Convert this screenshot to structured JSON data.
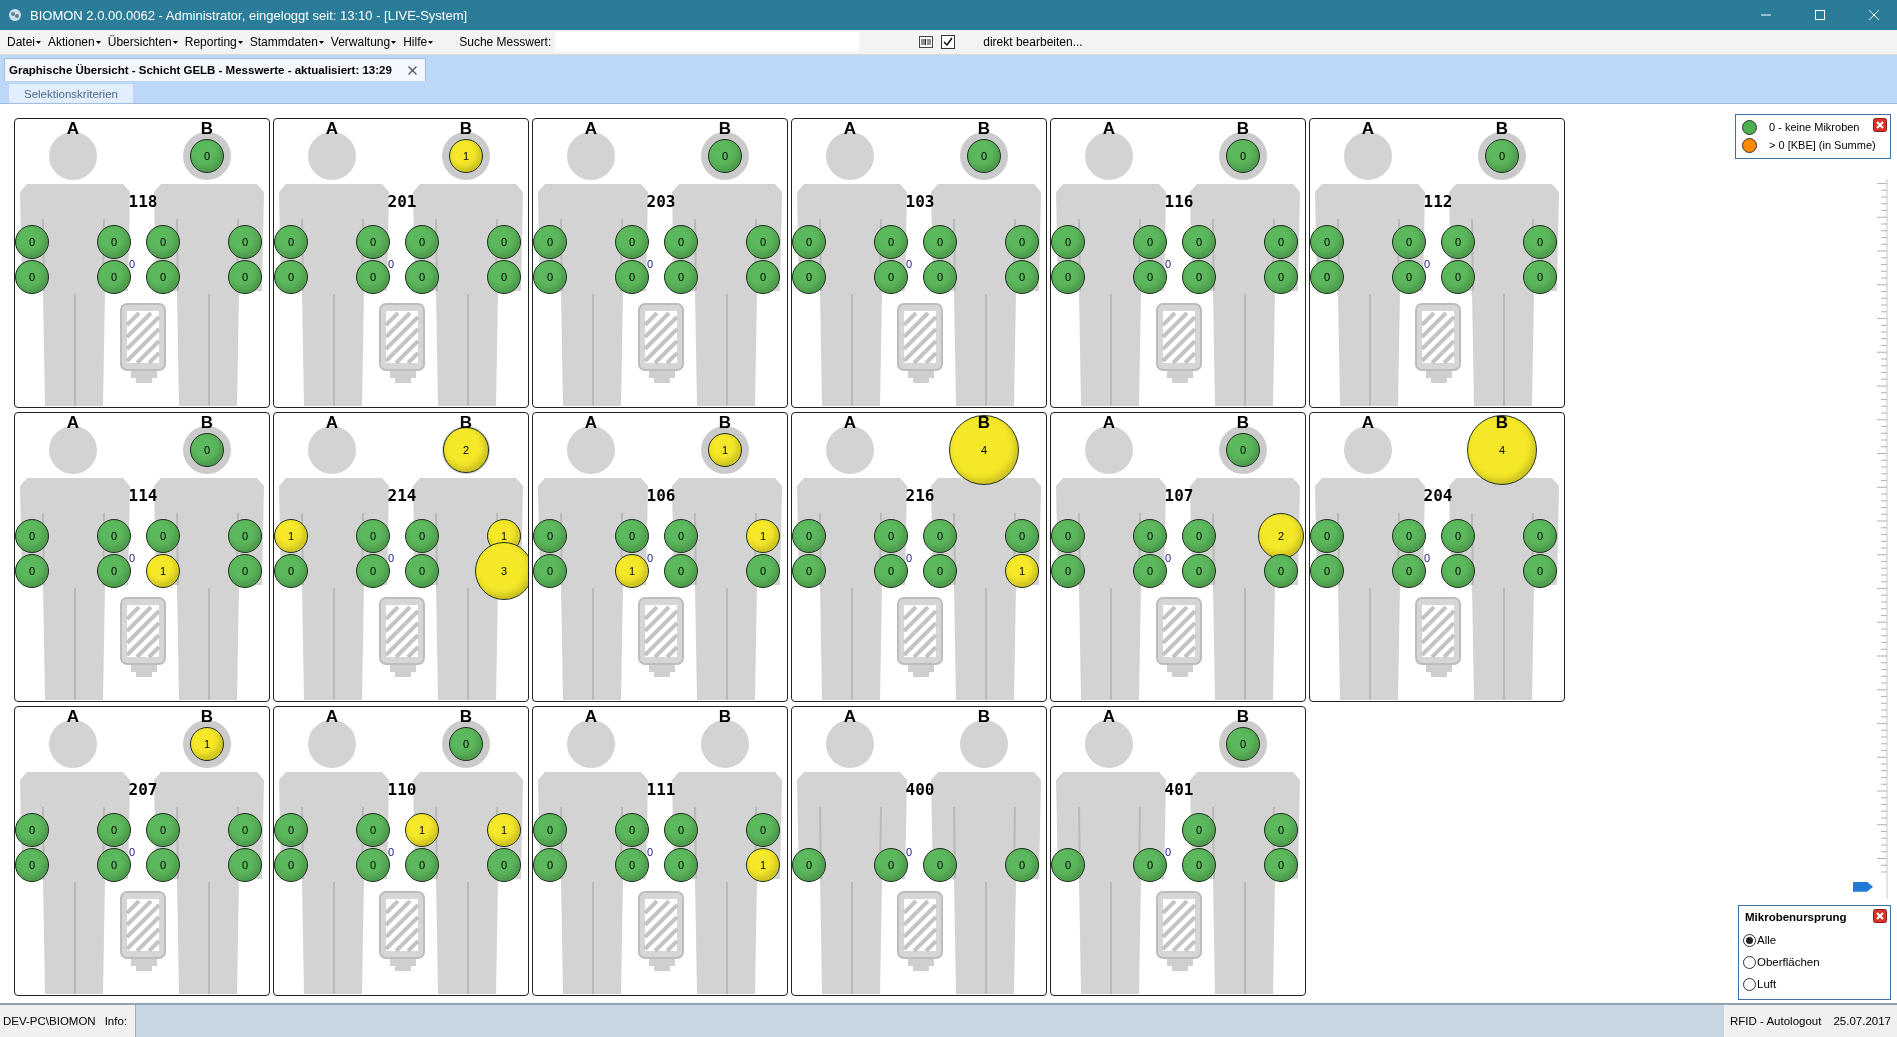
{
  "window": {
    "title": "BIOMON 2.0.00.0062 - Administrator, eingeloggt seit: 13:10 - [LIVE-System]"
  },
  "menu": [
    {
      "label": "Datei"
    },
    {
      "label": "Aktionen"
    },
    {
      "label": "Übersichten"
    },
    {
      "label": "Reporting"
    },
    {
      "label": "Stammdaten"
    },
    {
      "label": "Verwaltung"
    },
    {
      "label": "Hilfe"
    }
  ],
  "search": {
    "label": "Suche Messwert:"
  },
  "edit_toggle": {
    "checked": true,
    "label": "direkt bearbeiten..."
  },
  "tabs": [
    {
      "label": "Graphische Übersicht - Schicht GELB - Messwerte - aktualisiert: 13:29",
      "selected": true
    }
  ],
  "subtabs": [
    {
      "label": "Selektionskriterien",
      "selected": true
    }
  ],
  "rooms": [
    {
      "number": "118",
      "labels": [
        "A",
        "B"
      ],
      "head": {
        "value": "0",
        "color": "#5cb85c"
      },
      "hands": [
        {
          "upper": {
            "value": "0",
            "color": "#5cb85c"
          },
          "lower": {
            "value": "0",
            "color": "#5cb85c"
          }
        },
        {
          "upper": {
            "value": "0",
            "color": "#5cb85c"
          },
          "lower": {
            "value": "0",
            "color": "#5cb85c"
          }
        },
        {
          "upper": {
            "value": "0",
            "color": "#5cb85c"
          },
          "lower": {
            "value": "0",
            "color": "#5cb85c"
          }
        },
        {
          "upper": {
            "value": "0",
            "color": "#5cb85c"
          },
          "lower": {
            "value": "0",
            "color": "#5cb85c"
          }
        }
      ],
      "center": "0"
    },
    {
      "number": "201",
      "labels": [
        "A",
        "B"
      ],
      "head": {
        "value": "1",
        "color": "#f5e829"
      },
      "hands": [
        {
          "upper": {
            "value": "0",
            "color": "#5cb85c"
          },
          "lower": {
            "value": "0",
            "color": "#5cb85c"
          }
        },
        {
          "upper": {
            "value": "0",
            "color": "#5cb85c"
          },
          "lower": {
            "value": "0",
            "color": "#5cb85c"
          }
        },
        {
          "upper": {
            "value": "0",
            "color": "#5cb85c"
          },
          "lower": {
            "value": "0",
            "color": "#5cb85c"
          }
        },
        {
          "upper": {
            "value": "0",
            "color": "#5cb85c"
          },
          "lower": {
            "value": "0",
            "color": "#5cb85c"
          }
        }
      ],
      "center": "0"
    },
    {
      "number": "203",
      "labels": [
        "A",
        "B"
      ],
      "head": {
        "value": "0",
        "color": "#5cb85c"
      },
      "hands": [
        {
          "upper": {
            "value": "0",
            "color": "#5cb85c"
          },
          "lower": {
            "value": "0",
            "color": "#5cb85c"
          }
        },
        {
          "upper": {
            "value": "0",
            "color": "#5cb85c"
          },
          "lower": {
            "value": "0",
            "color": "#5cb85c"
          }
        },
        {
          "upper": {
            "value": "0",
            "color": "#5cb85c"
          },
          "lower": {
            "value": "0",
            "color": "#5cb85c"
          }
        },
        {
          "upper": {
            "value": "0",
            "color": "#5cb85c"
          },
          "lower": {
            "value": "0",
            "color": "#5cb85c"
          }
        }
      ],
      "center": "0"
    },
    {
      "number": "103",
      "labels": [
        "A",
        "B"
      ],
      "head": {
        "value": "0",
        "color": "#5cb85c"
      },
      "hands": [
        {
          "upper": {
            "value": "0",
            "color": "#5cb85c"
          },
          "lower": {
            "value": "0",
            "color": "#5cb85c"
          }
        },
        {
          "upper": {
            "value": "0",
            "color": "#5cb85c"
          },
          "lower": {
            "value": "0",
            "color": "#5cb85c"
          }
        },
        {
          "upper": {
            "value": "0",
            "color": "#5cb85c"
          },
          "lower": {
            "value": "0",
            "color": "#5cb85c"
          }
        },
        {
          "upper": {
            "value": "0",
            "color": "#5cb85c"
          },
          "lower": {
            "value": "0",
            "color": "#5cb85c"
          }
        }
      ],
      "center": "0"
    },
    {
      "number": "116",
      "labels": [
        "A",
        "B"
      ],
      "head": {
        "value": "0",
        "color": "#5cb85c"
      },
      "hands": [
        {
          "upper": {
            "value": "0",
            "color": "#5cb85c"
          },
          "lower": {
            "value": "0",
            "color": "#5cb85c"
          }
        },
        {
          "upper": {
            "value": "0",
            "color": "#5cb85c"
          },
          "lower": {
            "value": "0",
            "color": "#5cb85c"
          }
        },
        {
          "upper": {
            "value": "0",
            "color": "#5cb85c"
          },
          "lower": {
            "value": "0",
            "color": "#5cb85c"
          }
        },
        {
          "upper": {
            "value": "0",
            "color": "#5cb85c"
          },
          "lower": {
            "value": "0",
            "color": "#5cb85c"
          }
        }
      ],
      "center": "0"
    },
    {
      "number": "112",
      "labels": [
        "A",
        "B"
      ],
      "head": {
        "value": "0",
        "color": "#5cb85c"
      },
      "hands": [
        {
          "upper": {
            "value": "0",
            "color": "#5cb85c"
          },
          "lower": {
            "value": "0",
            "color": "#5cb85c"
          }
        },
        {
          "upper": {
            "value": "0",
            "color": "#5cb85c"
          },
          "lower": {
            "value": "0",
            "color": "#5cb85c"
          }
        },
        {
          "upper": {
            "value": "0",
            "color": "#5cb85c"
          },
          "lower": {
            "value": "0",
            "color": "#5cb85c"
          }
        },
        {
          "upper": {
            "value": "0",
            "color": "#5cb85c"
          },
          "lower": {
            "value": "0",
            "color": "#5cb85c"
          }
        }
      ],
      "center": "0"
    },
    {
      "number": "114",
      "labels": [
        "A",
        "B"
      ],
      "head": {
        "value": "0",
        "color": "#5cb85c"
      },
      "hands": [
        {
          "upper": {
            "value": "0",
            "color": "#5cb85c"
          },
          "lower": {
            "value": "0",
            "color": "#5cb85c"
          }
        },
        {
          "upper": {
            "value": "0",
            "color": "#5cb85c"
          },
          "lower": {
            "value": "0",
            "color": "#5cb85c"
          }
        },
        {
          "upper": {
            "value": "0",
            "color": "#5cb85c"
          },
          "lower": {
            "value": "1",
            "color": "#f5e829"
          }
        },
        {
          "upper": {
            "value": "0",
            "color": "#5cb85c"
          },
          "lower": {
            "value": "0",
            "color": "#5cb85c"
          }
        }
      ],
      "center": "0"
    },
    {
      "number": "214",
      "labels": [
        "A",
        "B"
      ],
      "head": {
        "value": "2",
        "color": "#f5e829"
      },
      "hands": [
        {
          "upper": {
            "value": "1",
            "color": "#f5e829"
          },
          "lower": {
            "value": "0",
            "color": "#5cb85c"
          }
        },
        {
          "upper": {
            "value": "0",
            "color": "#5cb85c"
          },
          "lower": {
            "value": "0",
            "color": "#5cb85c"
          }
        },
        {
          "upper": {
            "value": "0",
            "color": "#5cb85c"
          },
          "lower": {
            "value": "0",
            "color": "#5cb85c"
          }
        },
        {
          "upper": {
            "value": "1",
            "color": "#f5e829"
          },
          "lower": {
            "value": "3",
            "color": "#f5e829"
          }
        }
      ],
      "center": "0"
    },
    {
      "number": "106",
      "labels": [
        "A",
        "B"
      ],
      "head": {
        "value": "1",
        "color": "#f5e829"
      },
      "hands": [
        {
          "upper": {
            "value": "0",
            "color": "#5cb85c"
          },
          "lower": {
            "value": "0",
            "color": "#5cb85c"
          }
        },
        {
          "upper": {
            "value": "0",
            "color": "#5cb85c"
          },
          "lower": {
            "value": "1",
            "color": "#f5e829"
          }
        },
        {
          "upper": {
            "value": "0",
            "color": "#5cb85c"
          },
          "lower": {
            "value": "0",
            "color": "#5cb85c"
          }
        },
        {
          "upper": {
            "value": "1",
            "color": "#f5e829"
          },
          "lower": {
            "value": "0",
            "color": "#5cb85c"
          }
        }
      ],
      "center": "0"
    },
    {
      "number": "216",
      "labels": [
        "A",
        "B"
      ],
      "head": {
        "value": "4",
        "color": "#f5e829"
      },
      "hands": [
        {
          "upper": {
            "value": "0",
            "color": "#5cb85c"
          },
          "lower": {
            "value": "0",
            "color": "#5cb85c"
          }
        },
        {
          "upper": {
            "value": "0",
            "color": "#5cb85c"
          },
          "lower": {
            "value": "0",
            "color": "#5cb85c"
          }
        },
        {
          "upper": {
            "value": "0",
            "color": "#5cb85c"
          },
          "lower": {
            "value": "0",
            "color": "#5cb85c"
          }
        },
        {
          "upper": {
            "value": "0",
            "color": "#5cb85c"
          },
          "lower": {
            "value": "1",
            "color": "#f5e829"
          }
        }
      ],
      "center": "0"
    },
    {
      "number": "107",
      "labels": [
        "A",
        "B"
      ],
      "head": {
        "value": "0",
        "color": "#5cb85c"
      },
      "hands": [
        {
          "upper": {
            "value": "0",
            "color": "#5cb85c"
          },
          "lower": {
            "value": "0",
            "color": "#5cb85c"
          }
        },
        {
          "upper": {
            "value": "0",
            "color": "#5cb85c"
          },
          "lower": {
            "value": "0",
            "color": "#5cb85c"
          }
        },
        {
          "upper": {
            "value": "0",
            "color": "#5cb85c"
          },
          "lower": {
            "value": "0",
            "color": "#5cb85c"
          }
        },
        {
          "upper": {
            "value": "2",
            "color": "#f5e829"
          },
          "lower": {
            "value": "0",
            "color": "#5cb85c"
          }
        }
      ],
      "center": "0"
    },
    {
      "number": "204",
      "labels": [
        "A",
        "B"
      ],
      "head": {
        "value": "4",
        "color": "#f5e829"
      },
      "hands": [
        {
          "upper": {
            "value": "0",
            "color": "#5cb85c"
          },
          "lower": {
            "value": "0",
            "color": "#5cb85c"
          }
        },
        {
          "upper": {
            "value": "0",
            "color": "#5cb85c"
          },
          "lower": {
            "value": "0",
            "color": "#5cb85c"
          }
        },
        {
          "upper": {
            "value": "0",
            "color": "#5cb85c"
          },
          "lower": {
            "value": "0",
            "color": "#5cb85c"
          }
        },
        {
          "upper": {
            "value": "0",
            "color": "#5cb85c"
          },
          "lower": {
            "value": "0",
            "color": "#5cb85c"
          }
        }
      ],
      "center": "0"
    },
    {
      "number": "207",
      "labels": [
        "A",
        "B"
      ],
      "head": {
        "value": "1",
        "color": "#f5e829"
      },
      "hands": [
        {
          "upper": {
            "value": "0",
            "color": "#5cb85c"
          },
          "lower": {
            "value": "0",
            "color": "#5cb85c"
          }
        },
        {
          "upper": {
            "value": "0",
            "color": "#5cb85c"
          },
          "lower": {
            "value": "0",
            "color": "#5cb85c"
          }
        },
        {
          "upper": {
            "value": "0",
            "color": "#5cb85c"
          },
          "lower": {
            "value": "0",
            "color": "#5cb85c"
          }
        },
        {
          "upper": {
            "value": "0",
            "color": "#5cb85c"
          },
          "lower": {
            "value": "0",
            "color": "#5cb85c"
          }
        }
      ],
      "center": "0"
    },
    {
      "number": "110",
      "labels": [
        "A",
        "B"
      ],
      "head": {
        "value": "0",
        "color": "#5cb85c"
      },
      "hands": [
        {
          "upper": {
            "value": "0",
            "color": "#5cb85c"
          },
          "lower": {
            "value": "0",
            "color": "#5cb85c"
          }
        },
        {
          "upper": {
            "value": "0",
            "color": "#5cb85c"
          },
          "lower": {
            "value": "0",
            "color": "#5cb85c"
          }
        },
        {
          "upper": {
            "value": "1",
            "color": "#f5e829"
          },
          "lower": {
            "value": "0",
            "color": "#5cb85c"
          }
        },
        {
          "upper": {
            "value": "1",
            "color": "#f5e829"
          },
          "lower": {
            "value": "0",
            "color": "#5cb85c"
          }
        }
      ],
      "center": "0"
    },
    {
      "number": "111",
      "labels": [
        "A",
        "B"
      ],
      "hands": [
        {
          "upper": {
            "value": "0",
            "color": "#5cb85c"
          },
          "lower": {
            "value": "0",
            "color": "#5cb85c"
          }
        },
        {
          "upper": {
            "value": "0",
            "color": "#5cb85c"
          },
          "lower": {
            "value": "0",
            "color": "#5cb85c"
          }
        },
        {
          "upper": {
            "value": "0",
            "color": "#5cb85c"
          },
          "lower": {
            "value": "0",
            "color": "#5cb85c"
          }
        },
        {
          "upper": {
            "value": "0",
            "color": "#5cb85c"
          },
          "lower": {
            "value": "1",
            "color": "#f5e829"
          }
        }
      ],
      "center": "0"
    },
    {
      "number": "400",
      "labels": [
        "A",
        "B"
      ],
      "hands": [
        {
          "lower": {
            "value": "0",
            "color": "#5cb85c"
          }
        },
        {
          "lower": {
            "value": "0",
            "color": "#5cb85c"
          }
        },
        {
          "lower": {
            "value": "0",
            "color": "#5cb85c"
          }
        },
        {
          "lower": {
            "value": "0",
            "color": "#5cb85c"
          }
        }
      ],
      "center": "0"
    },
    {
      "number": "401",
      "labels": [
        "A",
        "B"
      ],
      "head": {
        "value": "0",
        "color": "#5cb85c"
      },
      "hands": [
        {
          "lower": {
            "value": "0",
            "color": "#5cb85c"
          }
        },
        {
          "lower": {
            "value": "0",
            "color": "#5cb85c"
          }
        },
        {
          "upper": {
            "value": "0",
            "color": "#5cb85c"
          },
          "lower": {
            "value": "0",
            "color": "#5cb85c"
          }
        },
        {
          "upper": {
            "value": "0",
            "color": "#5cb85c"
          },
          "lower": {
            "value": "0",
            "color": "#5cb85c"
          }
        }
      ],
      "center": "0"
    }
  ],
  "scale_slider": {
    "level": 0.01
  },
  "legend": [
    {
      "label": "0 - keine Mikroben",
      "color": "#4caf50"
    },
    {
      "label": "> 0 [KBE] (in Summe)",
      "color": "#ff8a00"
    }
  ],
  "origin_filter": {
    "title": "Mikrobenursprung",
    "options": [
      {
        "label": "Alle",
        "selected": true
      },
      {
        "label": "Oberflächen",
        "selected": false
      },
      {
        "label": "Luft",
        "selected": false
      }
    ]
  },
  "status_bar": {
    "user": "DEV-PC\\BIOMON",
    "info_label": "Info:",
    "rfid": "RFID - Autologout",
    "date": "25.07.2017"
  }
}
